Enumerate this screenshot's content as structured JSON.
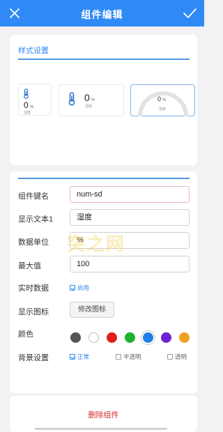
{
  "header": {
    "title": "组件编辑"
  },
  "style_section": {
    "title": "样式设置",
    "previews": [
      {
        "value": "0",
        "unit": "%",
        "label": "湿度"
      },
      {
        "value": "0",
        "unit": "%",
        "label": "湿度"
      },
      {
        "value": "0",
        "unit": "%",
        "label": "湿度"
      }
    ]
  },
  "form": {
    "key_label": "组件键名",
    "key_value": "num-sd",
    "text_label": "显示文本1",
    "text_value": "湿度",
    "unit_label": "数据单位",
    "unit_value": "%",
    "max_label": "最大值",
    "max_value": "100",
    "realtime_label": "实时数据",
    "realtime_option": "启用",
    "realtime_enabled": true,
    "icon_label": "显示图标",
    "icon_button": "修改图标",
    "color_label": "颜色",
    "colors": [
      "#555555",
      "#ffffff",
      "#e01e1e",
      "#1fb32d",
      "#1e7ee8",
      "#6b22d6",
      "#f0a020"
    ],
    "selected_color": "#1e7ee8",
    "bg_label": "背景设置",
    "bg_options": [
      "正常",
      "半透明",
      "透明"
    ],
    "bg_selected": "正常"
  },
  "actions": {
    "delete_label": "删除组件"
  },
  "watermark": "突之网"
}
